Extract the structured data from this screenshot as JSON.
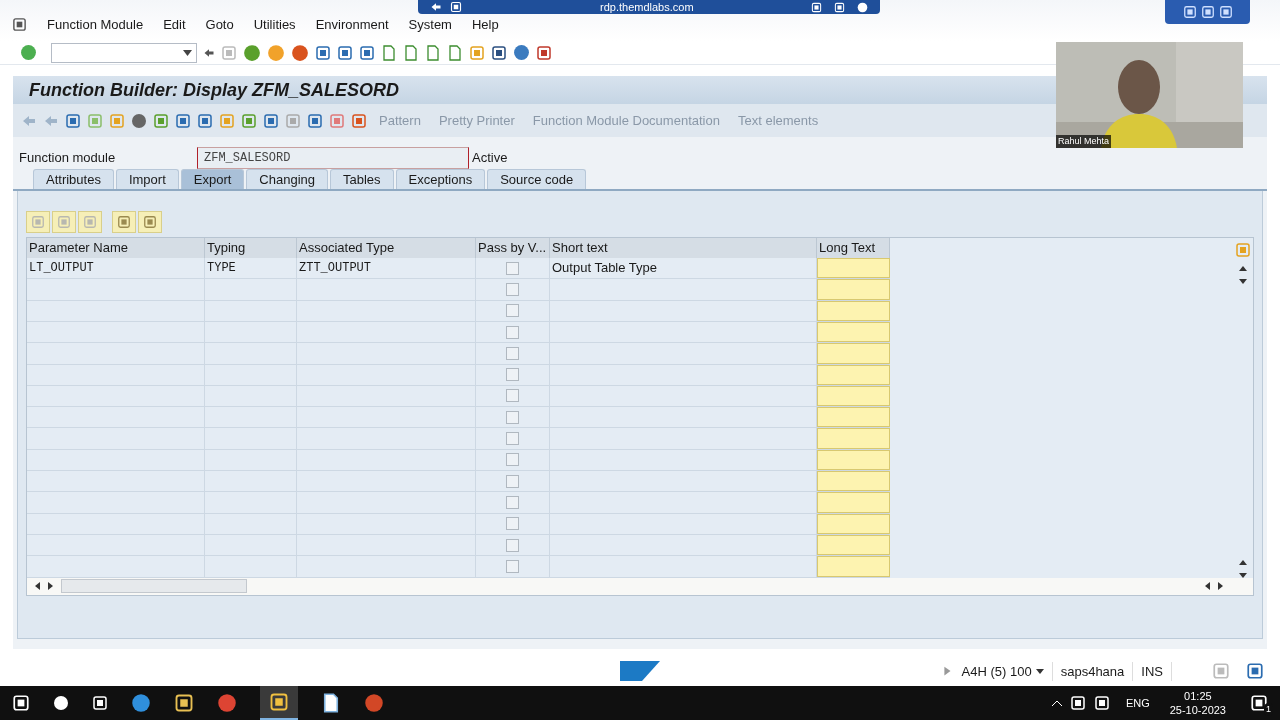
{
  "rdp_bar": {
    "title": "rdp.themdlabs.com"
  },
  "menu": [
    "Function Module",
    "Edit",
    "Goto",
    "Utilities",
    "Environment",
    "System",
    "Help"
  ],
  "title": "Function Builder: Display ZFM_SALESORD",
  "app_toolbar": [
    "Pattern",
    "Pretty Printer",
    "Function Module Documentation",
    "Text elements"
  ],
  "function_module": {
    "label": "Function module",
    "value": "ZFM_SALESORD",
    "status": "Active"
  },
  "tabs": [
    {
      "label": "Attributes",
      "selected": false
    },
    {
      "label": "Import",
      "selected": false
    },
    {
      "label": "Export",
      "selected": true
    },
    {
      "label": "Changing",
      "selected": false
    },
    {
      "label": "Tables",
      "selected": false
    },
    {
      "label": "Exceptions",
      "selected": false
    },
    {
      "label": "Source code",
      "selected": false
    }
  ],
  "table": {
    "columns": [
      "Parameter Name",
      "Typing",
      "Associated Type",
      "Pass by V...",
      "Short text",
      "Long Text"
    ],
    "rows": [
      {
        "parameter": "LT_OUTPUT",
        "typing": "TYPE",
        "associated_type": "ZTT_OUTPUT",
        "pass_by_value": false,
        "short_text": "Output Table Type"
      },
      {
        "pass_by_value": false
      },
      {
        "pass_by_value": false
      },
      {
        "pass_by_value": false
      },
      {
        "pass_by_value": false
      },
      {
        "pass_by_value": false
      },
      {
        "pass_by_value": false
      },
      {
        "pass_by_value": false
      },
      {
        "pass_by_value": false
      },
      {
        "pass_by_value": false
      },
      {
        "pass_by_value": false
      },
      {
        "pass_by_value": false
      },
      {
        "pass_by_value": false
      },
      {
        "pass_by_value": false
      },
      {
        "pass_by_value": false
      }
    ]
  },
  "status_bar": {
    "system": "A4H (5) 100",
    "server": "saps4hana",
    "mode": "INS"
  },
  "webcam": {
    "kind": "picture",
    "name": "Rahul Mehta"
  },
  "taskbar": {
    "language": "ENG",
    "time": "01:25",
    "date": "25-10-2023",
    "notifications": "1"
  }
}
